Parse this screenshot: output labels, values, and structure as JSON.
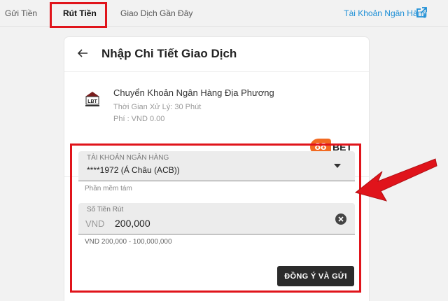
{
  "tabs": [
    {
      "label": "Gửi Tiền"
    },
    {
      "label": "Rút Tiền"
    },
    {
      "label": "Giao Dịch Gần Đây"
    }
  ],
  "bank_link": "Tài Khoản Ngân Hàng",
  "card": {
    "title": "Nhập Chi Tiết Giao Dịch"
  },
  "method": {
    "logo_text": "LBT",
    "name": "Chuyển Khoản Ngân Hàng Địa Phương",
    "processing_time": "Thời Gian Xử Lý: 30 Phút",
    "fee": "Phí : VND 0.00",
    "brand_number": "88",
    "brand_word": "BET"
  },
  "form": {
    "bank_account_label": "TÀI KHOẢN NGÂN HÀNG",
    "bank_account_value": "****1972 (Á Châu (ACB))",
    "bank_account_hint": "Phần mềm tám",
    "amount_label": "Số Tiền Rút",
    "amount_currency": "VND",
    "amount_value": "200,000",
    "amount_range": "VND 200,000 - 100,000,000",
    "submit_label": "ĐỒNG Ý VÀ GỬI"
  },
  "colors": {
    "highlight": "#e0141b",
    "link": "#1e8fd6",
    "brand_orange": "#f26a21"
  },
  "icons": [
    "external-link-icon",
    "back-arrow-icon",
    "lbt-bank-icon",
    "dropdown-caret-icon",
    "clear-icon",
    "pointer-arrow-icon"
  ]
}
